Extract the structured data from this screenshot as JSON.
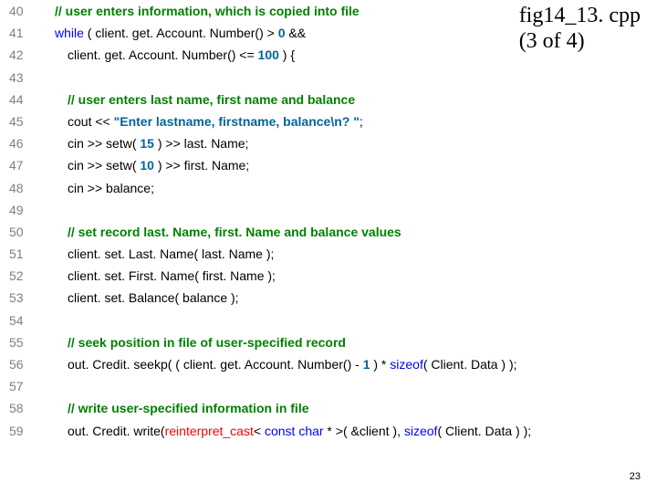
{
  "header": {
    "title": "fig14_13. cpp",
    "subtitle": "(3 of 4)"
  },
  "page_number": "23",
  "lines": [
    {
      "n": "40",
      "indent": 1,
      "tokens": [
        {
          "t": "// user enters information, which is copied into file",
          "c": "comment"
        }
      ]
    },
    {
      "n": "41",
      "indent": 1,
      "tokens": [
        {
          "t": "while",
          "c": "kw"
        },
        {
          "t": " ( client. get. Account. Number() > "
        },
        {
          "t": "0",
          "c": "num"
        },
        {
          "t": " && "
        }
      ]
    },
    {
      "n": "42",
      "indent": 2,
      "tokens": [
        {
          "t": "client. get. Account. Number() <= "
        },
        {
          "t": "100",
          "c": "num"
        },
        {
          "t": " ) {"
        }
      ]
    },
    {
      "n": "43",
      "indent": 0,
      "tokens": []
    },
    {
      "n": "44",
      "indent": 2,
      "tokens": [
        {
          "t": "// user enters last name, first name and balance",
          "c": "comment"
        }
      ]
    },
    {
      "n": "45",
      "indent": 2,
      "tokens": [
        {
          "t": "cout << "
        },
        {
          "t": "\"Enter lastname, firstname, balance\\n? \"",
          "c": "num"
        },
        {
          "t": ";"
        }
      ]
    },
    {
      "n": "46",
      "indent": 2,
      "tokens": [
        {
          "t": "cin >> setw( "
        },
        {
          "t": "15",
          "c": "num"
        },
        {
          "t": " ) >> last. Name;"
        }
      ]
    },
    {
      "n": "47",
      "indent": 2,
      "tokens": [
        {
          "t": "cin >> setw( "
        },
        {
          "t": "10",
          "c": "num"
        },
        {
          "t": " ) >> first. Name;"
        }
      ]
    },
    {
      "n": "48",
      "indent": 2,
      "tokens": [
        {
          "t": "cin >> balance;"
        }
      ]
    },
    {
      "n": "49",
      "indent": 0,
      "tokens": []
    },
    {
      "n": "50",
      "indent": 2,
      "tokens": [
        {
          "t": "// set record last. Name, first. Name and balance values",
          "c": "comment"
        }
      ]
    },
    {
      "n": "51",
      "indent": 2,
      "tokens": [
        {
          "t": "client. set. Last. Name( last. Name ); "
        }
      ]
    },
    {
      "n": "52",
      "indent": 2,
      "tokens": [
        {
          "t": "client. set. First. Name( first. Name ); "
        }
      ]
    },
    {
      "n": "53",
      "indent": 2,
      "tokens": [
        {
          "t": "client. set. Balance( balance ); "
        }
      ]
    },
    {
      "n": "54",
      "indent": 0,
      "tokens": []
    },
    {
      "n": "55",
      "indent": 2,
      "tokens": [
        {
          "t": "// seek position in file of user-specified record",
          "c": "comment"
        }
      ]
    },
    {
      "n": "56",
      "indent": 2,
      "tokens": [
        {
          "t": "out. Credit. seekp( ( client. get. Account. Number() - "
        },
        {
          "t": "1",
          "c": "num"
        },
        {
          "t": " ) *  "
        },
        {
          "t": "sizeof",
          "c": "kw"
        },
        {
          "t": "( Client. Data ) );"
        }
      ]
    },
    {
      "n": "57",
      "indent": 0,
      "tokens": []
    },
    {
      "n": "58",
      "indent": 2,
      "tokens": [
        {
          "t": "// write user-specified information in file",
          "c": "comment"
        }
      ]
    },
    {
      "n": "59",
      "indent": 2,
      "tokens": [
        {
          "t": "out. Credit. write("
        },
        {
          "t": "reinterpret_cast",
          "c": "cast"
        },
        {
          "t": "< "
        },
        {
          "t": "const",
          "c": "kw"
        },
        {
          "t": " "
        },
        {
          "t": "char",
          "c": "kw"
        },
        {
          "t": " * >( &client ),  "
        },
        {
          "t": "sizeof",
          "c": "kw"
        },
        {
          "t": "( Client. Data ) );"
        }
      ]
    }
  ]
}
